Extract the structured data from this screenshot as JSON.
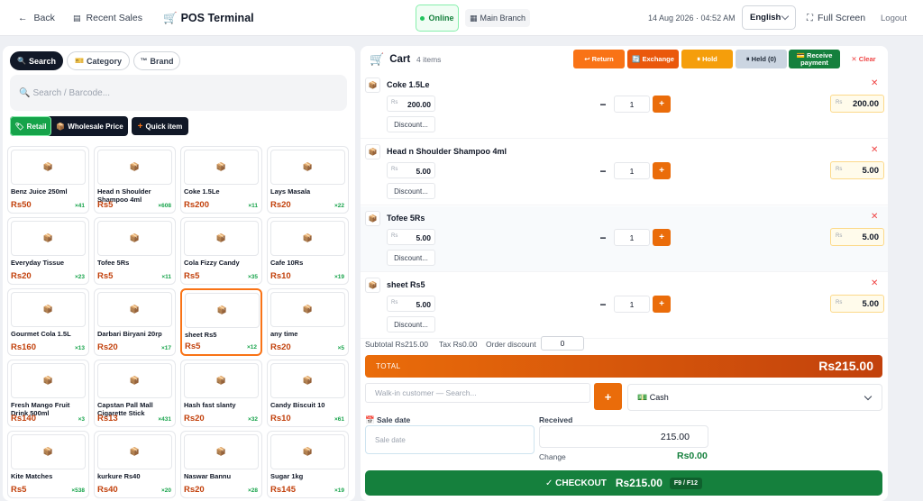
{
  "topbar": {
    "back_label": "Back",
    "recent_sales_label": "Recent Sales",
    "title": "POS Terminal",
    "status": "Online",
    "branch": "Main Branch",
    "datetime": "14 Aug 2026 · 04:52 AM",
    "language": "English",
    "fullscreen_label": "Full Screen",
    "logout_label": "Logout"
  },
  "products": {
    "filters": [
      {
        "label": "Search",
        "icon": "search-icon",
        "active": true
      },
      {
        "label": "Category",
        "icon": "tag-icon",
        "active": false
      },
      {
        "label": "Brand",
        "icon": "tm-icon",
        "active": false
      }
    ],
    "search_placeholder": "Search / Barcode...",
    "price_modes": {
      "retail": "Retail",
      "wholesale": "Wholesale Price"
    },
    "quick_item_label": "Quick item",
    "items": [
      {
        "name": "Benz Juice 250ml",
        "price": "Rs50",
        "stock": "×41"
      },
      {
        "name": "Head n Shoulder Shampoo 4ml",
        "price": "Rs5",
        "stock": "×608"
      },
      {
        "name": "Coke 1.5Le",
        "price": "Rs200",
        "stock": "×11"
      },
      {
        "name": "Lays Masala",
        "price": "Rs20",
        "stock": "×22"
      },
      {
        "name": "Everyday Tissue",
        "price": "Rs20",
        "stock": "×23"
      },
      {
        "name": "Tofee 5Rs",
        "price": "Rs5",
        "stock": "×11"
      },
      {
        "name": "Cola Fizzy Candy",
        "price": "Rs5",
        "stock": "×35"
      },
      {
        "name": "Cafe 10Rs",
        "price": "Rs10",
        "stock": "×19"
      },
      {
        "name": "Gourmet Cola 1.5L",
        "price": "Rs160",
        "stock": "×13"
      },
      {
        "name": "Darbari Biryani 20rp",
        "price": "Rs20",
        "stock": "×17"
      },
      {
        "name": "sheet Rs5",
        "price": "Rs5",
        "stock": "×12",
        "selected": true
      },
      {
        "name": "any time",
        "price": "Rs20",
        "stock": "×5"
      },
      {
        "name": "Fresh Mango Fruit Drink 500ml",
        "price": "Rs140",
        "stock": "×3"
      },
      {
        "name": "Capstan Pall Mall Cigarette Stick",
        "price": "Rs13",
        "stock": "×431"
      },
      {
        "name": "Hash fast slanty",
        "price": "Rs20",
        "stock": "×32"
      },
      {
        "name": "Candy Biscuit 10",
        "price": "Rs10",
        "stock": "×61"
      },
      {
        "name": "Kite Matches",
        "price": "Rs5",
        "stock": "×538"
      },
      {
        "name": "kurkure Rs40",
        "price": "Rs40",
        "stock": "×20"
      },
      {
        "name": "Naswar Bannu",
        "price": "Rs20",
        "stock": "×28"
      },
      {
        "name": "Sugar 1kg",
        "price": "Rs145",
        "stock": "×19"
      }
    ]
  },
  "cart": {
    "title": "Cart",
    "count": "4 items",
    "actions": [
      {
        "label": "↩ Return",
        "color": "#f97316"
      },
      {
        "label": "🔄 Exchange",
        "color": "#ea580c"
      },
      {
        "label": "⏸ Hold",
        "color": "#f59e0b"
      },
      {
        "label": "⏸ Held (0)",
        "color": "#cbd5e1"
      },
      {
        "label": "💳 Receive payment",
        "color": "#15803d"
      },
      {
        "label": "✕ Clear",
        "color": "#ef4444"
      }
    ],
    "currency_prefix": "Rs",
    "discount_label": "Discount...",
    "items": [
      {
        "name": "Coke 1.5Le",
        "price": "200.00",
        "qty": "1",
        "total": "200.00"
      },
      {
        "name": "Head n Shoulder Shampoo 4ml",
        "price": "5.00",
        "qty": "1",
        "total": "5.00"
      },
      {
        "name": "Tofee 5Rs",
        "price": "5.00",
        "qty": "1",
        "total": "5.00"
      },
      {
        "name": "sheet Rs5",
        "price": "5.00",
        "qty": "1",
        "total": "5.00"
      }
    ],
    "subtotal": "Subtotal Rs215.00",
    "tax": "Tax Rs0.00",
    "order_discount_label": "Order discount",
    "order_discount_value": "0",
    "total_label": "TOTAL",
    "total_value": "Rs215.00",
    "customer_placeholder": "Walk-in customer — Search...",
    "payment_method": "💵 Cash",
    "sale_date_label": "📅 Sale date",
    "sale_date_placeholder": "Sale date",
    "received_label": "Received",
    "received_value": "215.00",
    "change_label": "Change",
    "change_value": "Rs0.00",
    "checkout_label": "✓ CHECKOUT",
    "checkout_amount": "Rs215.00",
    "checkout_shortcut": "F9 / F12"
  }
}
